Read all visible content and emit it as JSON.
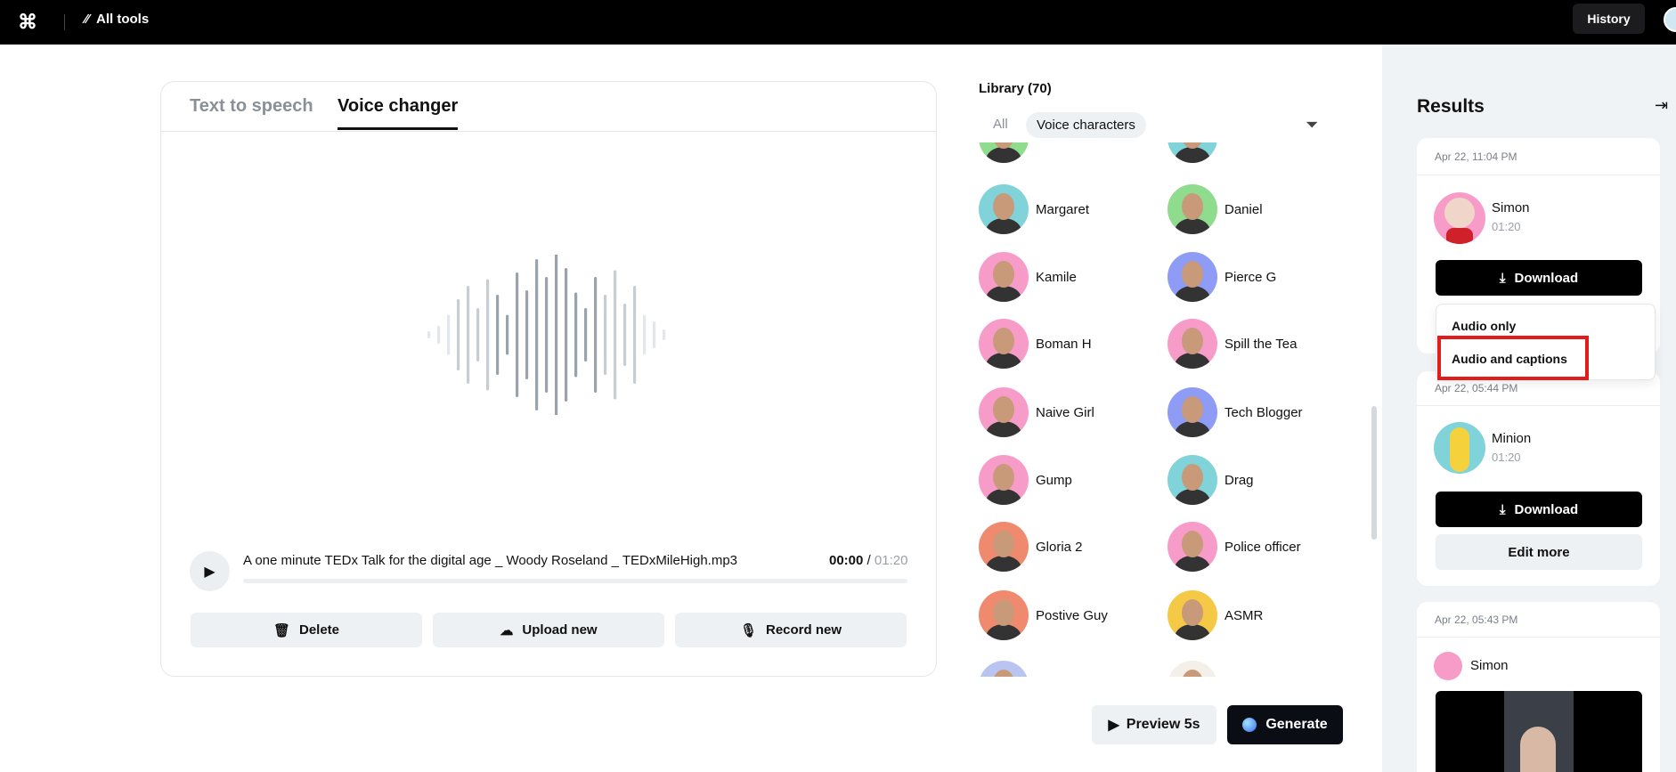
{
  "topbar": {
    "all_tools": "All tools",
    "history": "History"
  },
  "editor": {
    "tabs": [
      {
        "label": "Text to speech",
        "active": false
      },
      {
        "label": "Voice changer",
        "active": true
      }
    ],
    "file_name": "A one minute TEDx Talk for the digital age _ Woody Roseland _ TEDxMileHigh.mp3",
    "time_current": "00:00",
    "time_total": "01:20",
    "progress": 0,
    "buttons": {
      "delete": "Delete",
      "upload": "Upload new",
      "record": "Record new"
    }
  },
  "library": {
    "title": "Library (70)",
    "filters": {
      "all": "All",
      "voice_characters": "Voice characters"
    },
    "voices": [
      {
        "name": "Margaret",
        "color": "#7fd3d9"
      },
      {
        "name": "Daniel",
        "color": "#8fdc8f"
      },
      {
        "name": "Kamile",
        "color": "#f79bc8"
      },
      {
        "name": "Pierce G",
        "color": "#8e9cf5"
      },
      {
        "name": "Boman H",
        "color": "#f79bc8"
      },
      {
        "name": "Spill the Tea",
        "color": "#f79bc8"
      },
      {
        "name": "Naive Girl",
        "color": "#f79bc8"
      },
      {
        "name": "Tech Blogger",
        "color": "#8e9cf5"
      },
      {
        "name": "Gump",
        "color": "#f79bc8"
      },
      {
        "name": "Drag",
        "color": "#7fd3d9"
      },
      {
        "name": "Gloria 2",
        "color": "#f08a6e"
      },
      {
        "name": "Police officer",
        "color": "#f79bc8"
      },
      {
        "name": "Postive Guy",
        "color": "#f08a6e"
      },
      {
        "name": "ASMR",
        "color": "#f5c945"
      }
    ],
    "preview": "Preview 5s",
    "generate": "Generate"
  },
  "results": {
    "title": "Results",
    "items": [
      {
        "date": "Apr 22, 11:04 PM",
        "name": "Simon",
        "duration": "01:20",
        "download": "Download"
      },
      {
        "date": "Apr 22, 05:44 PM",
        "name": "Minion",
        "duration": "01:20",
        "download": "Download",
        "edit": "Edit more"
      },
      {
        "date": "Apr 22, 05:43 PM",
        "name": "Simon"
      }
    ],
    "dropdown": [
      "Audio only",
      "Audio and captions"
    ]
  }
}
